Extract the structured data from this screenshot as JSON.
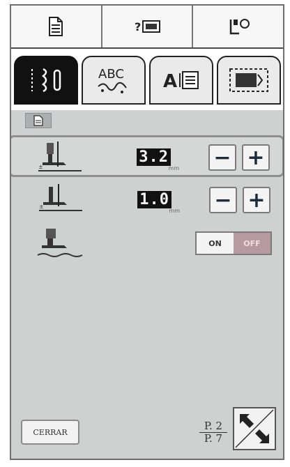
{
  "toolbar": {
    "icons": [
      "page-icon",
      "help-icon",
      "settings-icon"
    ]
  },
  "tabs": [
    {
      "name": "utility-stitch-tab",
      "active": true
    },
    {
      "name": "character-stitch-tab",
      "label": "ABC",
      "active": false
    },
    {
      "name": "letter-tab",
      "label": "A",
      "active": false
    },
    {
      "name": "embroidery-tab",
      "active": false
    }
  ],
  "settings": [
    {
      "name": "presser-foot-height",
      "value": "3.2",
      "unit": "mm",
      "selected": true
    },
    {
      "name": "presser-foot-pressure",
      "value": "1.0",
      "unit": "mm",
      "selected": false
    },
    {
      "name": "sensor-toggle",
      "on_label": "ON",
      "off_label": "OFF",
      "state": "OFF"
    }
  ],
  "buttons": {
    "minus": "−",
    "plus": "+",
    "close_label": "CERRAR"
  },
  "pagination": {
    "current": "P. 2",
    "total": "P. 7"
  },
  "colors": {
    "content_bg": "#cdd1d0",
    "toggle_off_bg": "#b69aa0",
    "active_tab": "#111111"
  }
}
